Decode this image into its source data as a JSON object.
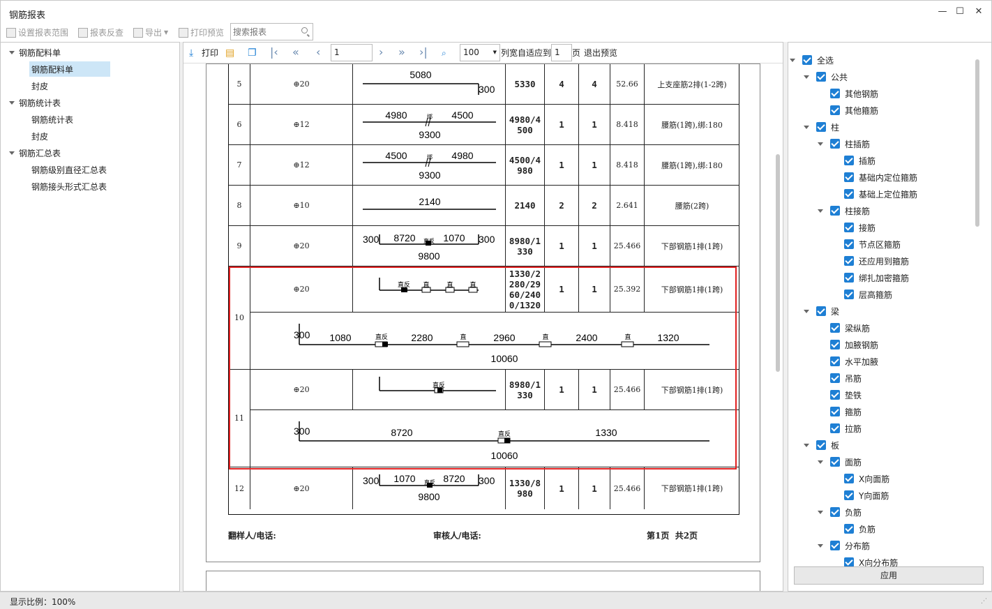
{
  "window": {
    "title": "钢筋报表"
  },
  "toolbar": {
    "set_range": "设置报表范围",
    "reverse_check": "报表反查",
    "export": "导出",
    "print_preview": "打印预览",
    "search_placeholder": "搜索报表"
  },
  "tree": [
    {
      "label": "钢筋配料单",
      "children": [
        "钢筋配料单",
        "封皮"
      ]
    },
    {
      "label": "钢筋统计表",
      "children": [
        "钢筋统计表",
        "封皮"
      ]
    },
    {
      "label": "钢筋汇总表",
      "children": [
        "钢筋级别直径汇总表",
        "钢筋接头形式汇总表"
      ]
    }
  ],
  "preview_toolbar": {
    "print": "打印",
    "page_input": "1",
    "zoom": "100",
    "fit_label": "列宽自适应到",
    "fit_value": "1",
    "page_unit": "页",
    "exit": "退出预览"
  },
  "table_rows": [
    {
      "no": "5",
      "spec": "⊕20",
      "length": "5330",
      "count1": "4",
      "count2": "4",
      "weight": "52.66",
      "remark": "上支座筋2排(1-2跨)"
    },
    {
      "no": "6",
      "spec": "⊕12",
      "length": "4980/4\n500",
      "count1": "1",
      "count2": "1",
      "weight": "8.418",
      "remark": "腰筋(1跨),绑:180"
    },
    {
      "no": "7",
      "spec": "⊕12",
      "length": "4500/4\n980",
      "count1": "1",
      "count2": "1",
      "weight": "8.418",
      "remark": "腰筋(1跨),绑:180"
    },
    {
      "no": "8",
      "spec": "⊕10",
      "length": "2140",
      "count1": "2",
      "count2": "2",
      "weight": "2.641",
      "remark": "腰筋(2跨)"
    },
    {
      "no": "9",
      "spec": "⊕20",
      "length": "8980/1\n330",
      "count1": "1",
      "count2": "1",
      "weight": "25.466",
      "remark": "下部钢筋1排(1跨)"
    },
    {
      "no": "10",
      "spec": "⊕20",
      "length": "1330/2\n280/29\n60/240\n0/1320",
      "count1": "1",
      "count2": "1",
      "weight": "25.392",
      "remark": "下部钢筋1排(1跨)"
    },
    {
      "no": "11",
      "spec": "⊕20",
      "length": "8980/1\n330",
      "count1": "1",
      "count2": "1",
      "weight": "25.466",
      "remark": "下部钢筋1排(1跨)"
    },
    {
      "no": "12",
      "spec": "⊕20",
      "length": "1330/8\n980",
      "count1": "1",
      "count2": "1",
      "weight": "25.466",
      "remark": "下部钢筋1排(1跨)"
    }
  ],
  "shapes": {
    "r5": {
      "top": "5080",
      "right": "300"
    },
    "r6": {
      "left": "4980",
      "right": "4500",
      "bottom": "9300",
      "mark": "绑"
    },
    "r7": {
      "left": "4500",
      "right": "4980",
      "bottom": "9300",
      "mark": "绑"
    },
    "r8": {
      "top": "2140"
    },
    "r9": {
      "l": "300",
      "a": "8720",
      "b": "1070",
      "r": "300",
      "bottom": "9800",
      "mark": "直反"
    },
    "r10": {
      "marks": [
        "直反",
        "直",
        "直",
        "直"
      ]
    },
    "r10big": {
      "start": "300",
      "segs": [
        "1080",
        "2280",
        "2960",
        "2400",
        "1320"
      ],
      "marks": [
        "直反",
        "直",
        "直",
        "直"
      ],
      "total": "10060"
    },
    "r11": {
      "mark": "直反"
    },
    "r11big": {
      "start": "300",
      "a": "8720",
      "b": "1330",
      "mark": "直反",
      "total": "10060"
    },
    "r12": {
      "l": "300",
      "a": "1070",
      "b": "8720",
      "r": "300",
      "bottom": "9800",
      "mark": "直反"
    }
  },
  "footer": {
    "sampler": "翻样人/电话:",
    "reviewer": "审核人/电话:",
    "page": "第1页  共2页"
  },
  "filter": {
    "items": [
      {
        "label": "全选",
        "level": 0,
        "expand": true
      },
      {
        "label": "公共",
        "level": 1,
        "expand": true
      },
      {
        "label": "其他钢筋",
        "level": 2
      },
      {
        "label": "其他箍筋",
        "level": 2
      },
      {
        "label": "柱",
        "level": 1,
        "expand": true
      },
      {
        "label": "柱插筋",
        "level": 2,
        "expand": true
      },
      {
        "label": "插筋",
        "level": 3
      },
      {
        "label": "基础内定位箍筋",
        "level": 3
      },
      {
        "label": "基础上定位箍筋",
        "level": 3
      },
      {
        "label": "柱接筋",
        "level": 2,
        "expand": true
      },
      {
        "label": "接筋",
        "level": 3
      },
      {
        "label": "节点区箍筋",
        "level": 3
      },
      {
        "label": "还应用到箍筋",
        "level": 3
      },
      {
        "label": "绑扎加密箍筋",
        "level": 3
      },
      {
        "label": "层高箍筋",
        "level": 3
      },
      {
        "label": "梁",
        "level": 1,
        "expand": true
      },
      {
        "label": "梁纵筋",
        "level": 2
      },
      {
        "label": "加腋钢筋",
        "level": 2
      },
      {
        "label": "水平加腋",
        "level": 2
      },
      {
        "label": "吊筋",
        "level": 2
      },
      {
        "label": "垫铁",
        "level": 2
      },
      {
        "label": "箍筋",
        "level": 2
      },
      {
        "label": "拉筋",
        "level": 2
      },
      {
        "label": "板",
        "level": 1,
        "expand": true
      },
      {
        "label": "面筋",
        "level": 2,
        "expand": true
      },
      {
        "label": "X向面筋",
        "level": 3
      },
      {
        "label": "Y向面筋",
        "level": 3
      },
      {
        "label": "负筋",
        "level": 2,
        "expand": true
      },
      {
        "label": "负筋",
        "level": 3
      },
      {
        "label": "分布筋",
        "level": 2,
        "expand": true
      },
      {
        "label": "X向分布筋",
        "level": 3
      }
    ],
    "apply": "应用"
  },
  "status": {
    "zoom_label": "显示比例：100%"
  }
}
